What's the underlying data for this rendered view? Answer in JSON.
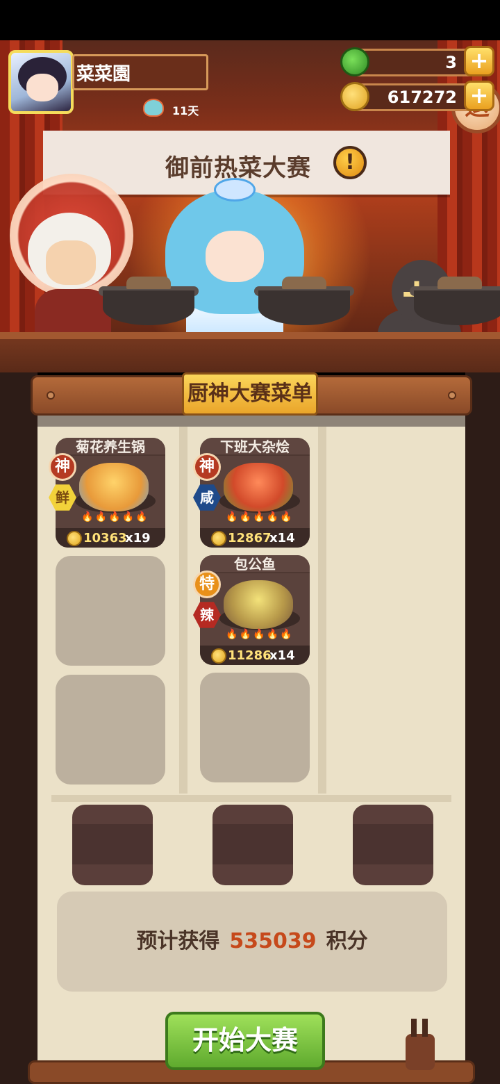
{
  "player": {
    "name": "菜菜園",
    "days": "11天"
  },
  "resources": {
    "jade": {
      "value": "3",
      "icon": "jade-icon",
      "plus": "+"
    },
    "coins": {
      "value": "617272",
      "icon": "coin-icon",
      "plus": "+"
    }
  },
  "stage": {
    "banner_title": "御前热菜大赛",
    "alert": "!",
    "exit_label": "退",
    "add_chef": "+"
  },
  "menu": {
    "title": "厨神大赛菜单",
    "dishes": [
      {
        "name": "菊花养生锅",
        "grade": "神",
        "flavor": "鲜",
        "flames": "🔥🔥🔥🔥🔥",
        "score": "10363",
        "multiplier": "x19",
        "grade_color": "#b53a22",
        "flavor_color": "#f2d23a"
      },
      {
        "name": "下班大杂烩",
        "grade": "神",
        "flavor": "咸",
        "flames": "🔥🔥🔥🔥🔥",
        "score": "12867",
        "multiplier": "x14",
        "grade_color": "#b53a22",
        "flavor_color": "#1f4a8a"
      },
      {
        "name": "包公鱼",
        "grade": "特",
        "flavor": "辣",
        "flames": "🔥🔥🔥🔥🔥",
        "score": "11286",
        "multiplier": "x14",
        "grade_color": "#e8901a",
        "flavor_color": "#b52a22"
      }
    ]
  },
  "estimate": {
    "prefix": "预计获得",
    "points": "535039",
    "suffix": "积分"
  },
  "start_button": "开始大赛"
}
